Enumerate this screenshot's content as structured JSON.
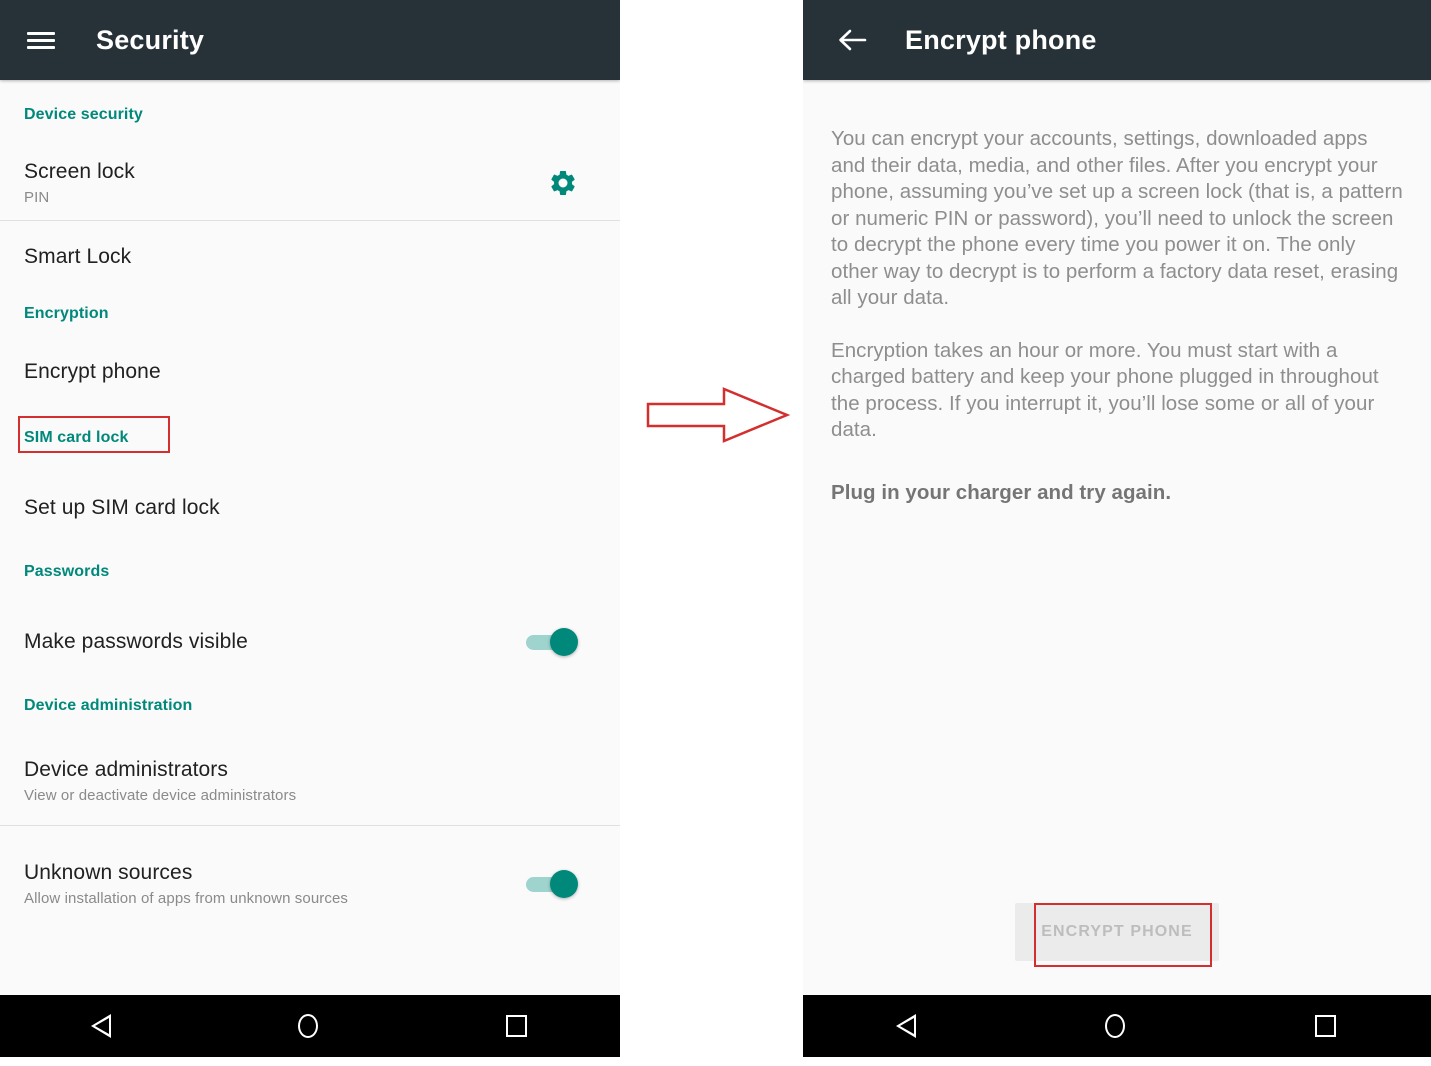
{
  "colors": {
    "appbar": "#263238",
    "accent_teal": "#00897b",
    "annotation_red": "#d32f2f",
    "background": "#fafafa",
    "navbar": "#000000"
  },
  "left_screen": {
    "appbar": {
      "menu_icon": "hamburger-menu-icon",
      "title": "Security"
    },
    "sections": [
      {
        "header": "Device security",
        "rows": [
          {
            "title": "Screen lock",
            "subtitle": "PIN",
            "control": "gear-icon"
          },
          {
            "title": "Smart Lock",
            "subtitle": "",
            "control": "none"
          }
        ]
      },
      {
        "header": "Encryption",
        "rows": [
          {
            "title": "Encrypt phone",
            "subtitle": "",
            "control": "none",
            "highlighted": true
          }
        ]
      },
      {
        "header": "SIM card lock",
        "rows": [
          {
            "title": "Set up SIM card lock",
            "subtitle": "",
            "control": "none"
          }
        ]
      },
      {
        "header": "Passwords",
        "rows": [
          {
            "title": "Make passwords visible",
            "subtitle": "",
            "control": "toggle",
            "toggle_state": "on"
          }
        ]
      },
      {
        "header": "Device administration",
        "rows": [
          {
            "title": "Device administrators",
            "subtitle": "View or deactivate device administrators",
            "control": "none"
          },
          {
            "title": "Unknown sources",
            "subtitle": "Allow installation of apps from unknown sources",
            "control": "toggle",
            "toggle_state": "on"
          }
        ]
      }
    ],
    "navbar": {
      "back": "back-triangle-icon",
      "home": "home-circle-icon",
      "recents": "recents-square-icon"
    }
  },
  "annotation": {
    "arrow": "right-arrow-annotation",
    "arrow_color": "#d32f2f"
  },
  "right_screen": {
    "appbar": {
      "back_icon": "back-arrow-icon",
      "title": "Encrypt phone"
    },
    "paragraph_1": "You can encrypt your accounts, settings, downloaded apps and their data, media, and other files. After you encrypt your phone, assuming you’ve set up a screen lock (that is, a pattern or numeric PIN or password), you’ll need to unlock the screen to decrypt the phone every time you power it on. The only other way to decrypt is to perform a factory data reset, erasing all your data.",
    "paragraph_2": "Encryption takes an hour or more. You must start with a charged battery and keep your phone plugged in throughout the process. If you interrupt it, you’ll lose some or all of your data.",
    "note": "Plug in your charger and try again.",
    "button": {
      "label": "ENCRYPT PHONE",
      "state": "disabled",
      "highlighted": true
    },
    "navbar": {
      "back": "back-triangle-icon",
      "home": "home-circle-icon",
      "recents": "recents-square-icon"
    }
  }
}
